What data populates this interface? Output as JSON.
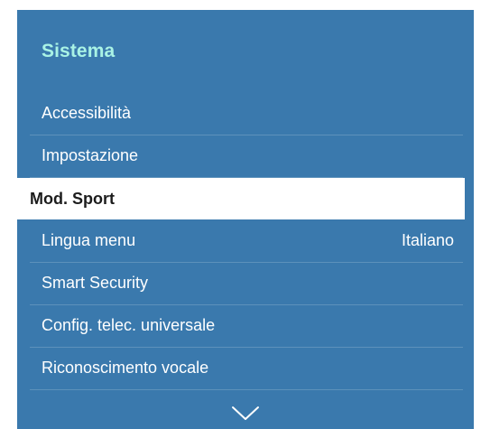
{
  "panel": {
    "title": "Sistema",
    "accent_color": "#a9f3e5",
    "background_color": "#3a79ad"
  },
  "items": [
    {
      "label": "Accessibilità",
      "value": ""
    },
    {
      "label": "Impostazione",
      "value": ""
    },
    {
      "label": "Mod. Sport",
      "value": "",
      "selected": true
    },
    {
      "label": "Lingua menu",
      "value": "Italiano"
    },
    {
      "label": "Smart Security",
      "value": ""
    },
    {
      "label": "Config. telec. universale",
      "value": ""
    },
    {
      "label": "Riconoscimento vocale",
      "value": ""
    }
  ],
  "scroll_icon": "chevron-down-icon"
}
